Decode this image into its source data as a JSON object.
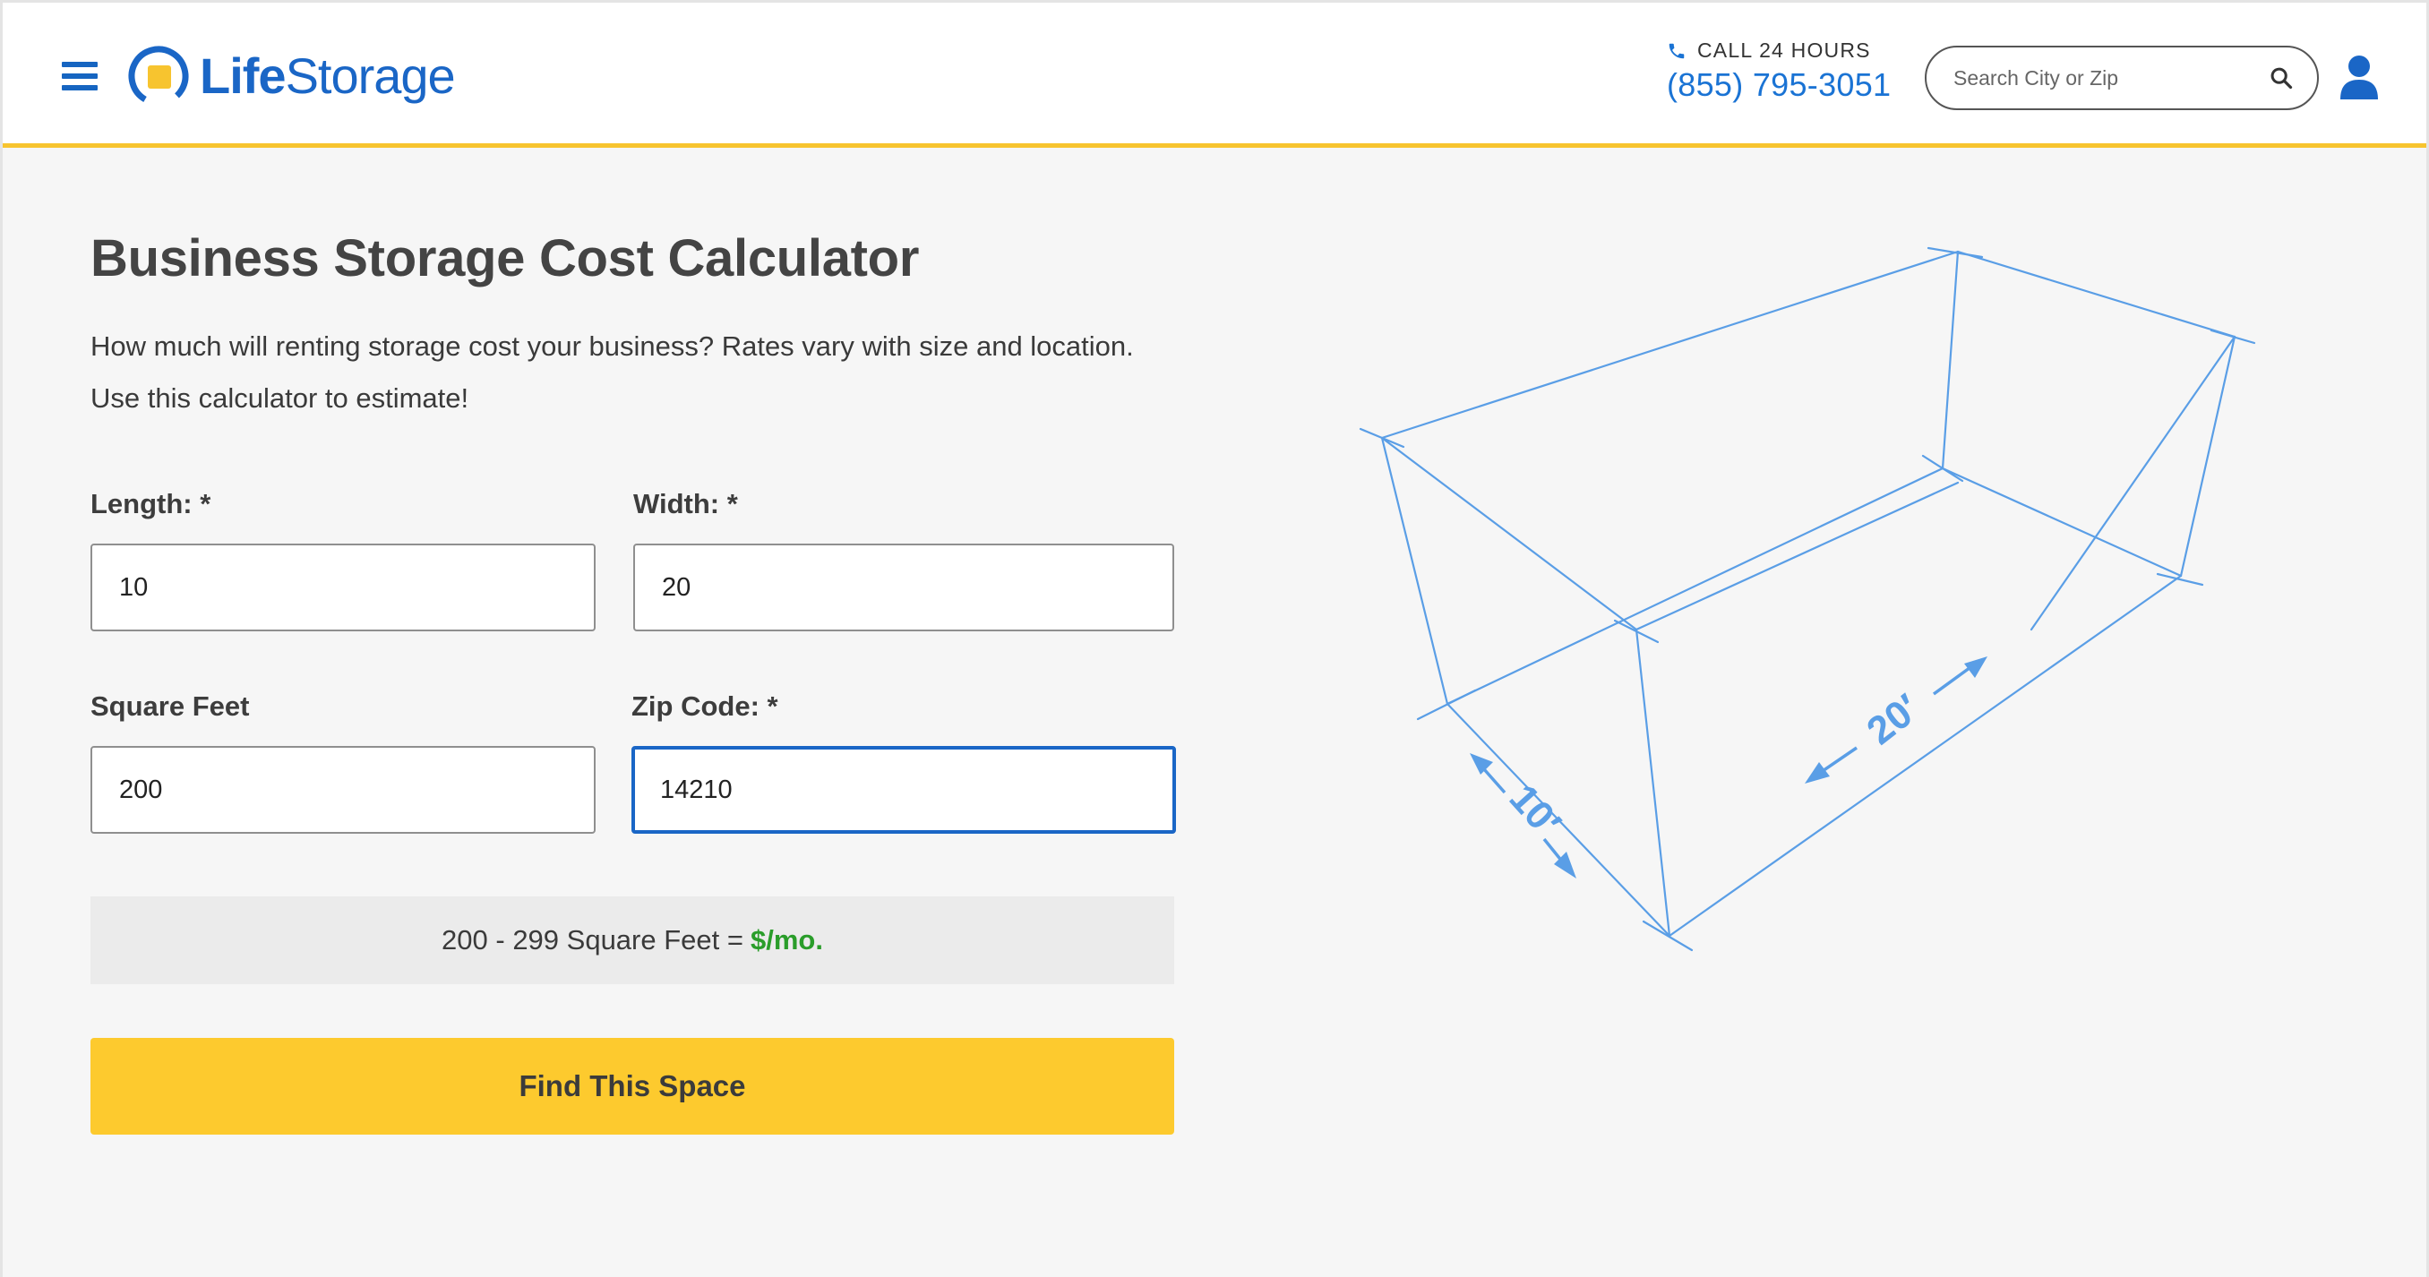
{
  "header": {
    "logo": {
      "bold": "Life",
      "regular": "Storage"
    },
    "call_label": "CALL 24 HOURS",
    "phone": "(855) 795-3051",
    "search_placeholder": "Search City or Zip"
  },
  "main": {
    "title": "Business Storage Cost Calculator",
    "description_line1": "How much will renting storage cost your business? Rates vary with size and location.",
    "description_line2": "Use this calculator to estimate!",
    "fields": {
      "length": {
        "label": "Length: *",
        "value": "10"
      },
      "width": {
        "label": "Width: *",
        "value": "20"
      },
      "square_feet": {
        "label": "Square Feet",
        "value": "200"
      },
      "zip": {
        "label": "Zip Code: *",
        "value": "14210"
      }
    },
    "result": {
      "range": "200 - 299 Square Feet =",
      "price": "$/mo."
    },
    "cta_label": "Find This Space"
  },
  "diagram": {
    "length_label": "10′",
    "width_label": "20′"
  },
  "colors": {
    "brand_blue": "#1a66c6",
    "accent_yellow": "#fdca2e",
    "price_green": "#2a9d2a",
    "diagram_blue": "#5a9ee6"
  }
}
